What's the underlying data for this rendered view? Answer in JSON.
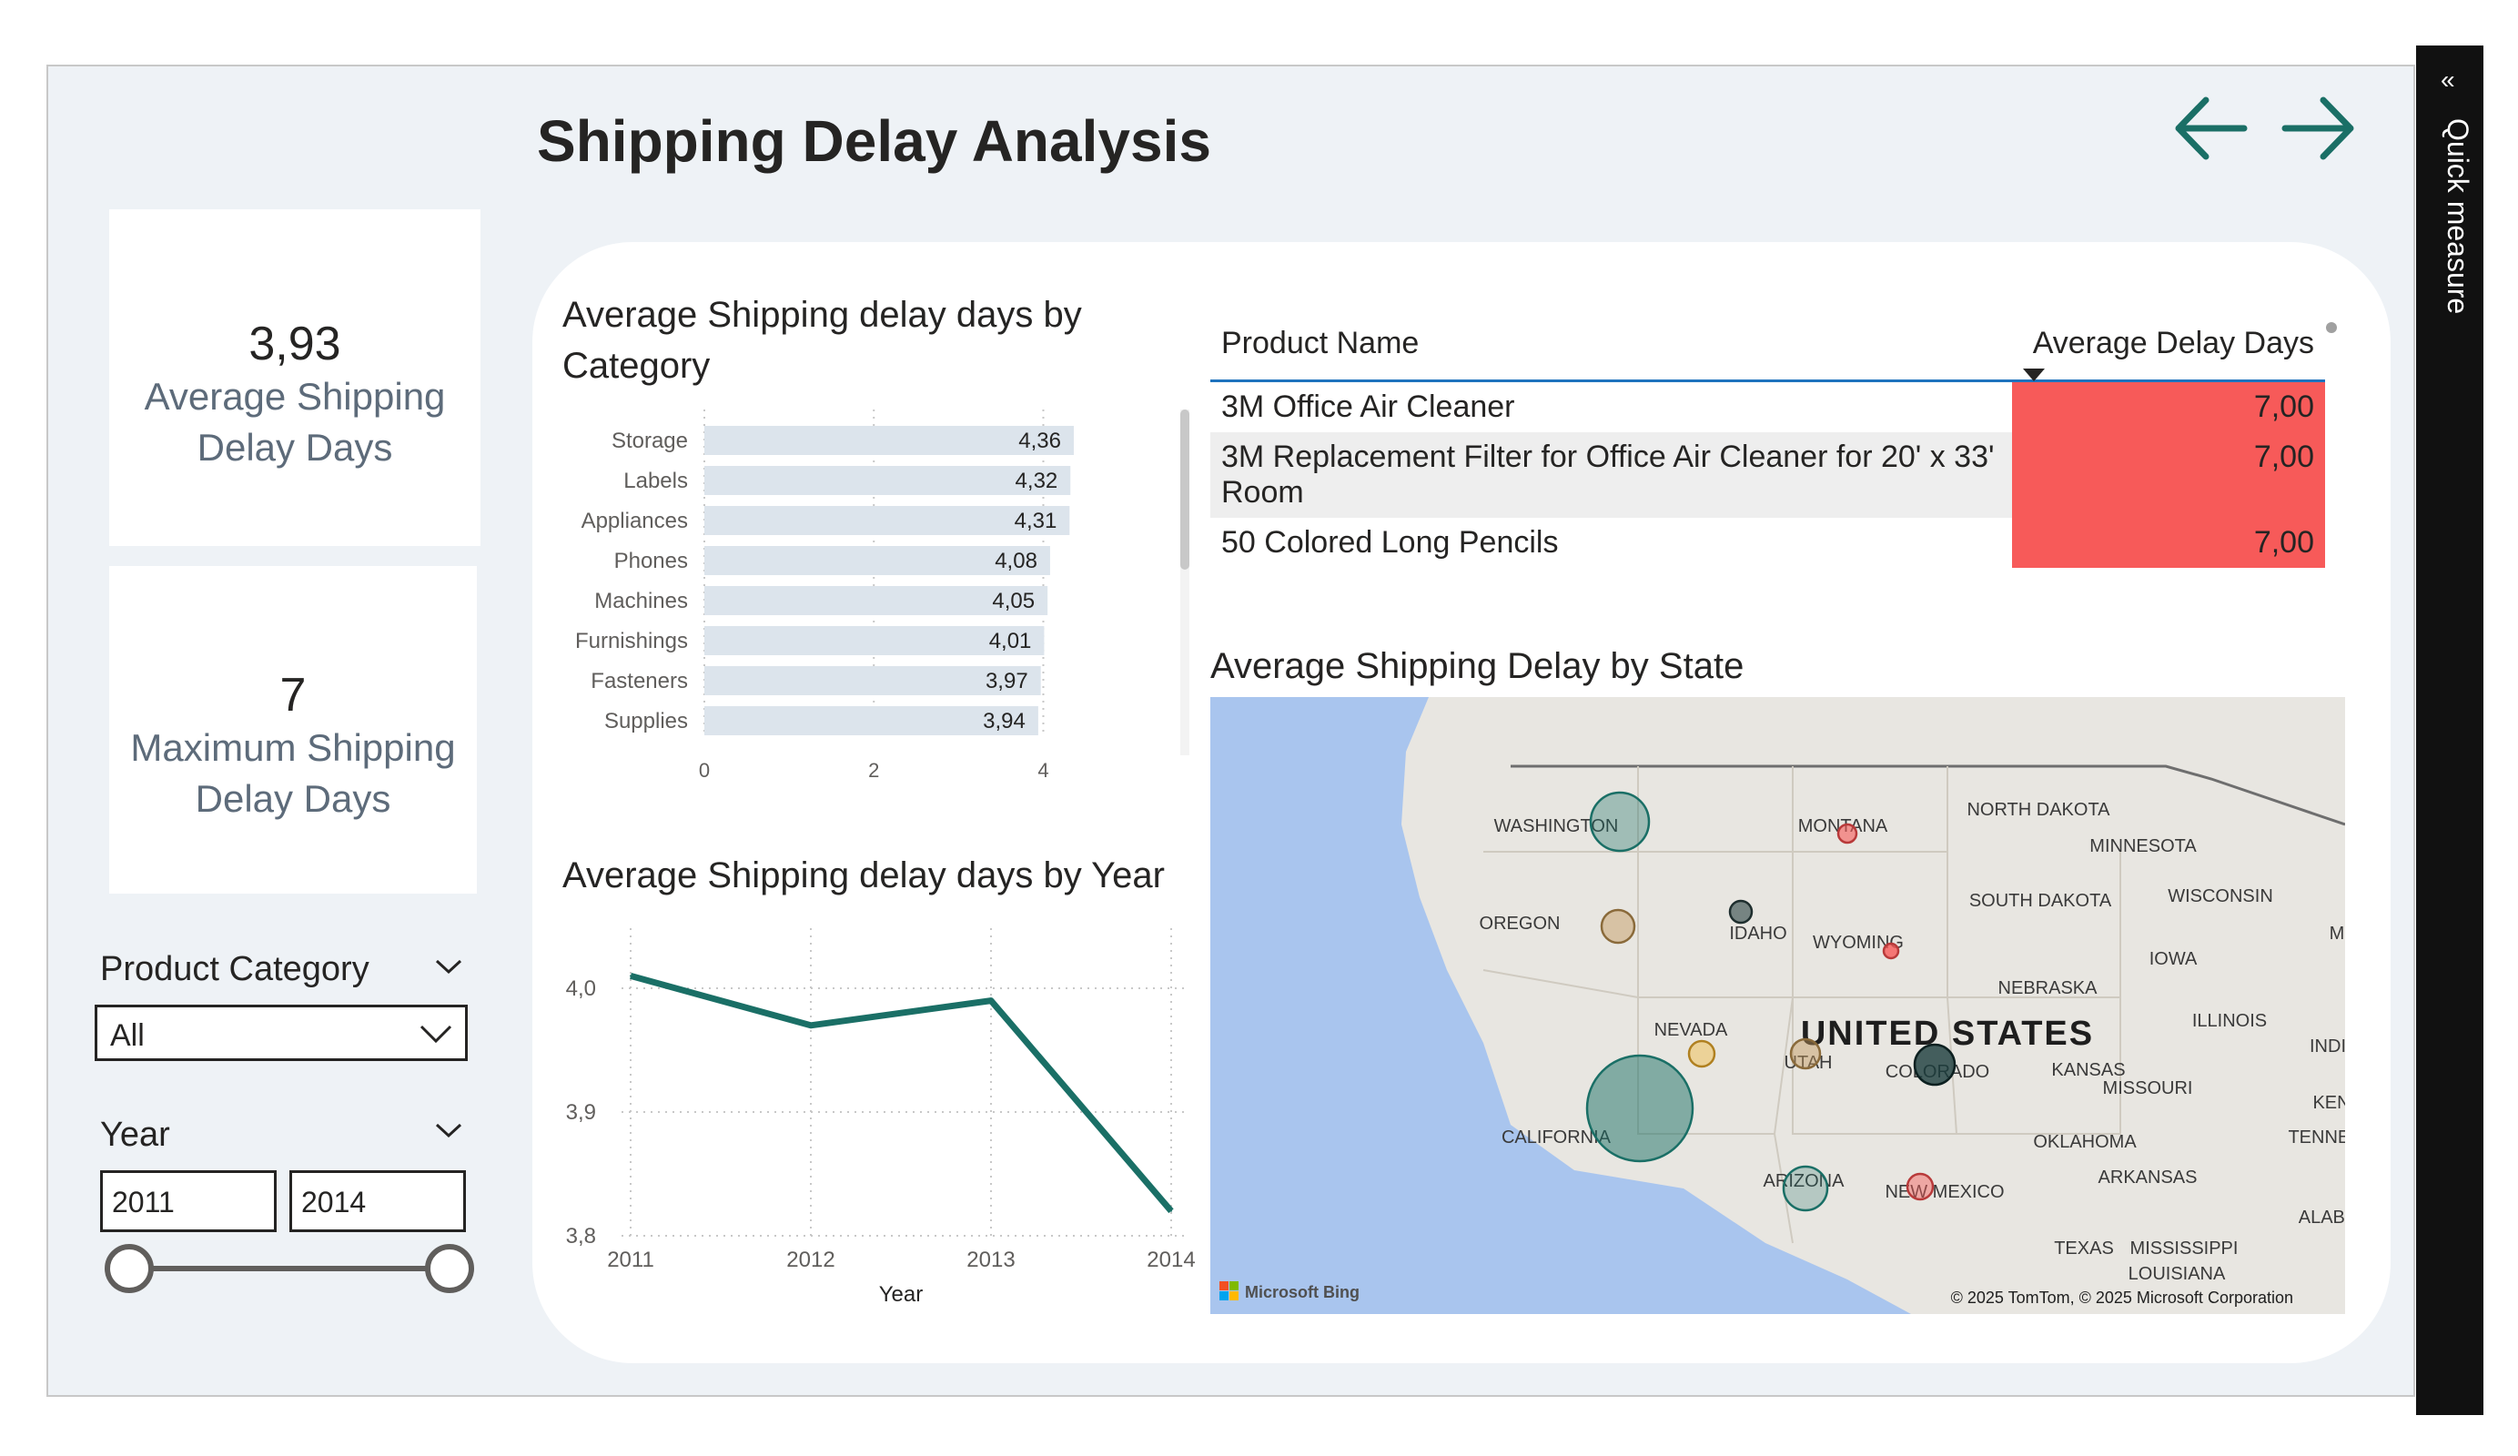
{
  "page": {
    "title": "Shipping Delay Analysis",
    "nav": {
      "back_icon": "arrow-left-icon",
      "forward_icon": "arrow-right-icon",
      "color": "#1a6f66"
    }
  },
  "quick_measure": {
    "label": "Quick measure",
    "icon": "chevron-left-icon"
  },
  "cards": [
    {
      "value": "3,93",
      "label": "Average Shipping Delay Days"
    },
    {
      "value": "7",
      "label": "Maximum Shipping Delay Days"
    }
  ],
  "slicers": {
    "category": {
      "title": "Product Category",
      "selected": "All"
    },
    "year": {
      "title": "Year",
      "from": "2011",
      "to": "2014"
    }
  },
  "colors": {
    "accent": "#1a6f66",
    "bar": "#dce4ec",
    "highlight": "#f75a59",
    "canvas": "#eef2f6"
  },
  "table": {
    "columns": [
      "Product Name",
      "Average Delay Days"
    ],
    "sort_icon": "sort-descending-icon",
    "rows": [
      {
        "name": "3M Office Air Cleaner",
        "value": "7,00"
      },
      {
        "name": "3M Replacement Filter for Office Air Cleaner for 20' x 33' Room",
        "value": "7,00"
      },
      {
        "name": "50 Colored Long Pencils",
        "value": "7,00"
      }
    ]
  },
  "map": {
    "title": "Average Shipping Delay by State",
    "country_label": "UNITED STATES",
    "state_labels": [
      "WASHINGTON",
      "MONTANA",
      "NORTH DAKOTA",
      "MINNESOTA",
      "OREGON",
      "IDAHO",
      "SOUTH DAKOTA",
      "WISCONSIN",
      "WYOMING",
      "NEBRASKA",
      "IOWA",
      "NEVADA",
      "UTAH",
      "COLORADO",
      "KANSAS",
      "ILLINOIS",
      "MISSOURI",
      "CALIFORNIA",
      "OKLAHOMA",
      "ARIZONA",
      "NEW MEXICO",
      "ARKANSAS",
      "TEXAS",
      "MISSISSIPPI",
      "INDI",
      "KEN",
      "TENNES",
      "ALABA",
      "LOUISIANA",
      "M"
    ],
    "attribution": "© 2025 TomTom, © 2025 Microsoft Corporation",
    "logo": "Microsoft Bing"
  },
  "chart_data": [
    {
      "type": "bar",
      "title": "Average Shipping delay days by Category",
      "categories": [
        "Storage",
        "Labels",
        "Appliances",
        "Phones",
        "Machines",
        "Furnishings",
        "Fasteners",
        "Supplies"
      ],
      "values": [
        4.36,
        4.32,
        4.31,
        4.08,
        4.05,
        4.01,
        3.97,
        3.94
      ],
      "value_labels": [
        "4,36",
        "4,32",
        "4,31",
        "4,08",
        "4,05",
        "4,01",
        "3,97",
        "3,94"
      ],
      "x_ticks": [
        "0",
        "2",
        "4"
      ],
      "xlim": [
        0,
        4.36
      ],
      "orientation": "horizontal",
      "grid": true
    },
    {
      "type": "line",
      "title": "Average Shipping delay days by Year",
      "x": [
        "2011",
        "2012",
        "2013",
        "2014"
      ],
      "values": [
        4.01,
        3.97,
        3.99,
        3.82
      ],
      "y_ticks": [
        "4,0",
        "3,9",
        "3,8"
      ],
      "ylim": [
        3.8,
        4.05
      ],
      "xlabel": "Year",
      "ylabel": "",
      "grid": true
    }
  ]
}
